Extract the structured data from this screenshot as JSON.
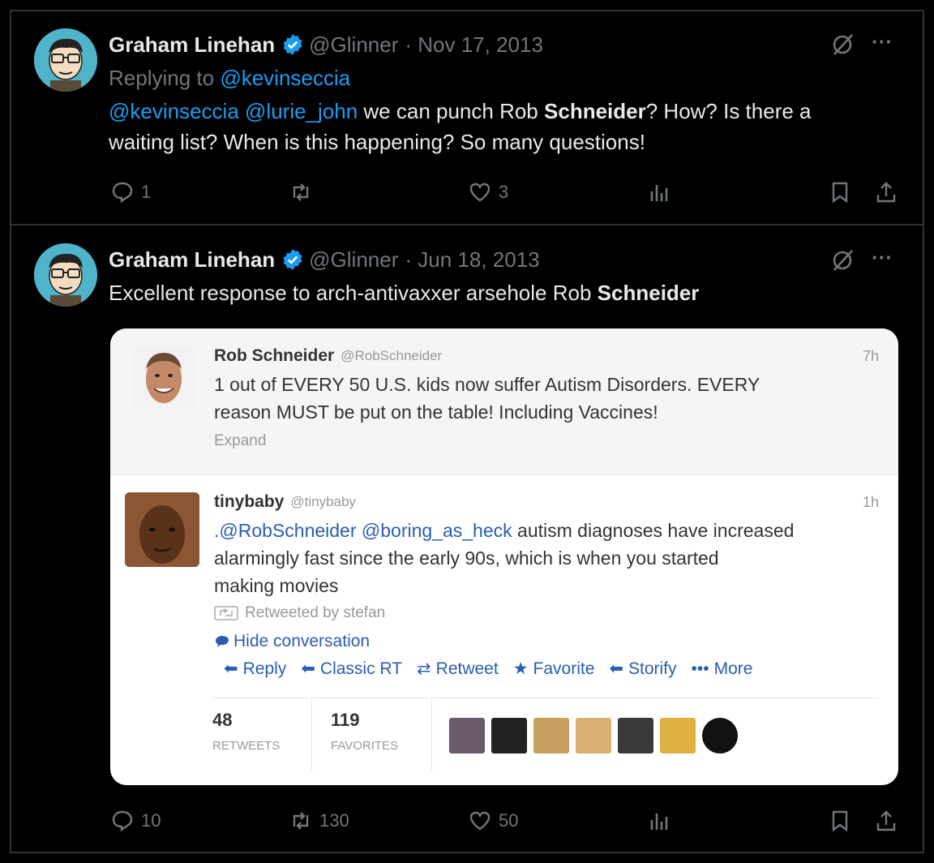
{
  "tweets": [
    {
      "author": "Graham Linehan",
      "handle": "@Glinner",
      "date": "· Nov 17, 2013",
      "replying_prefix": "Replying to",
      "replying_to": "@kevinseccia",
      "mention1": "@kevinseccia",
      "mention2": "@lurie_john",
      "text_part1": "we can punch Rob",
      "text_bold": "Schneider",
      "text_part2": "? How? Is there a",
      "text_line2": "waiting list? When is this happening? So many questions!",
      "replies": "1",
      "retweets": "",
      "likes": "3"
    },
    {
      "author": "Graham Linehan",
      "handle": "@Glinner",
      "date": "· Jun 18, 2013",
      "text_part1": "Excellent response to arch-antivaxxer arsehole Rob",
      "text_bold": "Schneider",
      "replies": "10",
      "retweets": "130",
      "likes": "50"
    }
  ],
  "more_label": "···",
  "embedded": {
    "top": {
      "name": "Rob Schneider",
      "handle": "@RobSchneider",
      "time": "7h",
      "line1": "1 out of EVERY 50 U.S. kids now suffer Autism Disorders. EVERY",
      "line2": "reason MUST be put on the table! Including Vaccines!",
      "expand": "Expand"
    },
    "reply": {
      "name": "tinybaby",
      "handle": "@tinybaby",
      "time": "1h",
      "mention1": ".@RobSchneider",
      "mention2": "@boring_as_heck",
      "line1_rest": "autism diagnoses have increased",
      "line2": "alarmingly fast since the early 90s, which is when you started",
      "line3": "making movies",
      "retweeted_by": "Retweeted by stefan",
      "hide_conversation": "Hide conversation",
      "actions": [
        "Reply",
        "Classic RT",
        "Retweet",
        "Favorite",
        "Storify",
        "More"
      ],
      "retweets_count": "48",
      "retweets_label": "RETWEETS",
      "favorites_count": "119",
      "favorites_label": "FAVORITES"
    }
  },
  "colors": {
    "background": "#000000",
    "link": "#1d9bf0",
    "muted": "#71767b",
    "verified": "#1d9bf0",
    "legacy_link": "#2a5db0"
  }
}
